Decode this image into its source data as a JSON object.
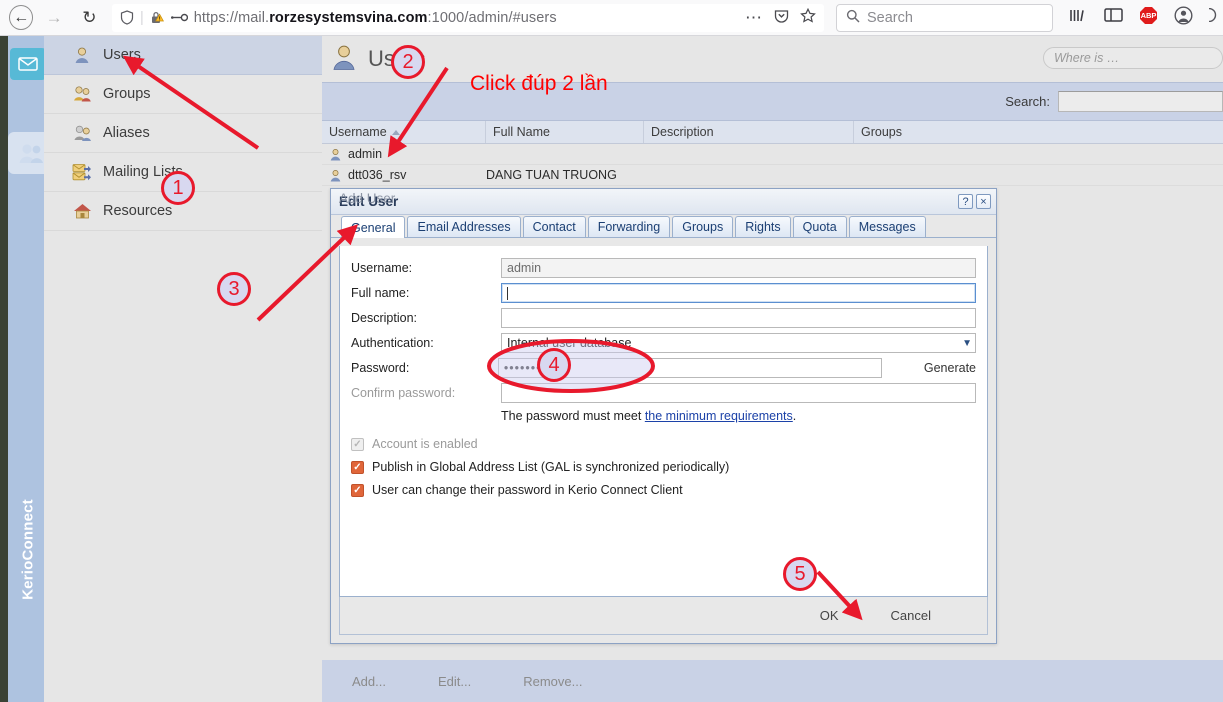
{
  "browser": {
    "back_icon": "back-arrow-icon",
    "forward_icon": "forward-arrow-icon",
    "reload_icon": "reload-icon",
    "shield_icon": "shield-icon",
    "lock_warning_icon": "lock-warning-icon",
    "permission_icon": "permission-key-icon",
    "url_prefix": "https://mail.",
    "url_domain": "rorzesystemsvina.com",
    "url_suffix": ":1000/admin/#users",
    "more_icon": "ellipsis-icon",
    "pocket_icon": "pocket-save-icon",
    "bookmark_icon": "star-bookmark-icon",
    "search_placeholder": "Search",
    "search_icon": "magnifier-icon",
    "library_icon": "library-icon",
    "sidebar_icon": "sidebar-toggle-icon",
    "adblock_icon": "abp-adblock-icon",
    "adblock_label": "ABP",
    "account_icon": "account-avatar-icon",
    "menu_icon": "hamburger-menu-icon"
  },
  "rail": {
    "brand": "KerioConnect",
    "mail_icon": "envelope-icon",
    "users_icon": "users-group-icon"
  },
  "sidebar": {
    "items": [
      {
        "label": "Users",
        "icon": "single-user-icon",
        "selected": true
      },
      {
        "label": "Groups",
        "icon": "group-users-icon",
        "selected": false
      },
      {
        "label": "Aliases",
        "icon": "aliases-users-icon",
        "selected": false
      },
      {
        "label": "Mailing Lists",
        "icon": "mailing-list-icon",
        "selected": false
      },
      {
        "label": "Resources",
        "icon": "house-resource-icon",
        "selected": false
      }
    ]
  },
  "page": {
    "title": "Users",
    "title_icon": "single-user-icon",
    "whereis_placeholder": "Where is …",
    "search_label": "Search:",
    "search_value": ""
  },
  "table": {
    "columns": [
      "Username",
      "Full Name",
      "Description",
      "Groups"
    ],
    "sort_column": "Username",
    "sort_direction": "asc",
    "rows": [
      {
        "username": "admin",
        "full_name": "",
        "description": "",
        "groups": ""
      },
      {
        "username": "dtt036_rsv",
        "full_name": "DANG TUAN TRUONG",
        "description": "",
        "groups": ""
      }
    ]
  },
  "dialog": {
    "title": "Edit User",
    "ghost_title": "Add User",
    "help_button": "?",
    "close_button": "×",
    "tabs": [
      {
        "label": "General",
        "active": true
      },
      {
        "label": "Email Addresses",
        "active": false
      },
      {
        "label": "Contact",
        "active": false
      },
      {
        "label": "Forwarding",
        "active": false
      },
      {
        "label": "Groups",
        "active": false
      },
      {
        "label": "Rights",
        "active": false
      },
      {
        "label": "Quota",
        "active": false
      },
      {
        "label": "Messages",
        "active": false
      }
    ],
    "fields": {
      "username_label": "Username:",
      "username_value": "admin",
      "fullname_label": "Full name:",
      "fullname_value": "",
      "description_label": "Description:",
      "description_value": "",
      "auth_label": "Authentication:",
      "auth_value": "Internal user database",
      "password_label": "Password:",
      "password_value": "•••••••••",
      "generate_label": "Generate",
      "confirm_label": "Confirm password:",
      "confirm_value": "",
      "hint_prefix": "The password must meet ",
      "hint_link": "the minimum requirements",
      "hint_suffix": "."
    },
    "checkboxes": [
      {
        "label": "Account is enabled",
        "checked": true,
        "disabled": true
      },
      {
        "label": "Publish in Global Address List (GAL is synchronized periodically)",
        "checked": true,
        "disabled": false
      },
      {
        "label": "User can change their password in Kerio Connect Client",
        "checked": true,
        "disabled": false
      }
    ],
    "ok_label": "OK",
    "cancel_label": "Cancel"
  },
  "bottom_toolbar": {
    "add_label": "Add...",
    "edit_label": "Edit...",
    "remove_label": "Remove..."
  },
  "annotations": {
    "color": "#e8192c",
    "text_note": "Click đúp 2 lần",
    "markers": [
      {
        "number": "1"
      },
      {
        "number": "2"
      },
      {
        "number": "3"
      },
      {
        "number": "4"
      },
      {
        "number": "5"
      }
    ]
  }
}
